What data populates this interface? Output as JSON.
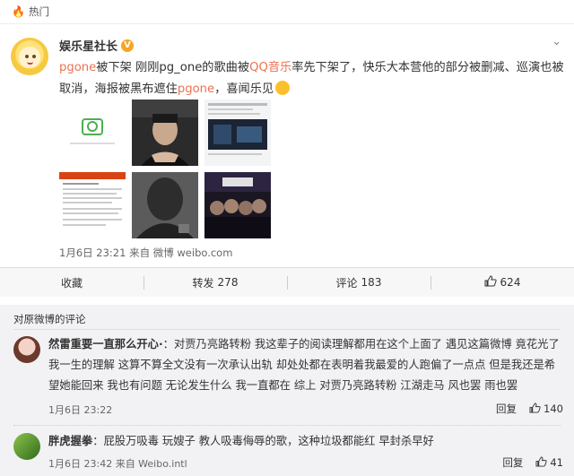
{
  "hot_header": {
    "label": "热门"
  },
  "post": {
    "author": "娱乐星社长",
    "text": {
      "hashtag1": "pgone",
      "part1": "被下架 刚刚pg_one的歌曲被",
      "hashtag2": "QQ音乐",
      "part2": "率先下架了，快乐大本营他的部分被删减、巡演也被取消，海报被黑布遮住",
      "hashtag3": "pgone",
      "part3": "，喜闻乐见"
    },
    "timestamp": "1月6日 23:21 来自 微博 weibo.com"
  },
  "actions": {
    "favorite": {
      "label": "收藏"
    },
    "repost": {
      "label": "转发",
      "count": "278"
    },
    "comment": {
      "label": "评论",
      "count": "183"
    },
    "like": {
      "count": "624"
    }
  },
  "comments_section": {
    "title": "对原微博的评论",
    "comments": [
      {
        "user": "然雷重要一直那么开心·",
        "text": "：对贾乃亮路转粉 我这辈子的阅读理解都用在这个上面了 遇见这篇微博 竟花光了我一生的理解 这算不算全文没有一次承认出轨 却处处都在表明着我最爱的人跑偏了一点点 但是我还是希望她能回来 我也有问题 无论发生什么 我一直都在 综上 对贾乃亮路转粉 江湖走马 风也罢 雨也罢",
        "time": "1月6日 23:22",
        "reply_label": "回复",
        "likes": "140"
      },
      {
        "user": "胖虎握拳",
        "text": "：屁股万吸毒 玩嫂子 教人吸毒侮辱的歌，这种垃圾都能红 早封杀早好",
        "time": "1月6日 23:42 来自 Weibo.intl",
        "reply_label": "回复",
        "likes": "41"
      }
    ]
  }
}
